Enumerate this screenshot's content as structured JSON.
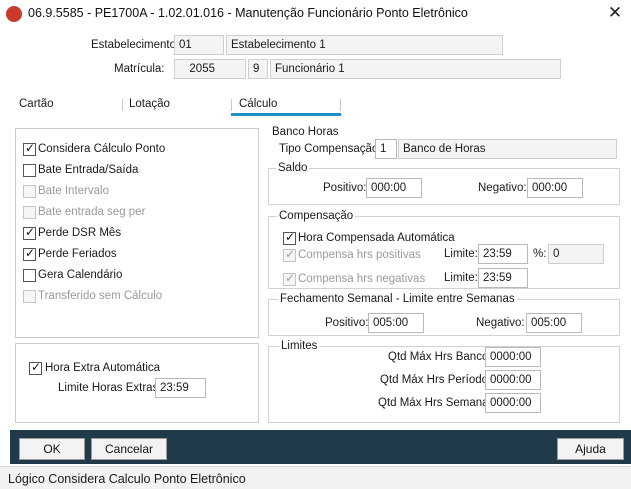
{
  "window": {
    "title": "06.9.5585 - PE1700A - 1.02.01.016 - Manutenção Funcionário Ponto Eletrônico",
    "app_icon": "TOTVS",
    "close_glyph": "✕"
  },
  "header": {
    "estabelecimento_label": "Estabelecimento:",
    "estabelecimento_code": "01",
    "estabelecimento_name": "Estabelecimento 1",
    "matricula_label": "Matrícula:",
    "matricula_code": "2055",
    "matricula_digit": "9",
    "matricula_name": "Funcionário 1"
  },
  "tabs": [
    {
      "label": "Cartão",
      "active": false
    },
    {
      "label": "Lotação",
      "active": false
    },
    {
      "label": "Cálculo",
      "active": true
    }
  ],
  "checkbox_glyph": "✓",
  "left_options": [
    {
      "label": "Considera Cálculo Ponto",
      "checked": true,
      "enabled": true
    },
    {
      "label": "Bate Entrada/Saída",
      "checked": false,
      "enabled": true
    },
    {
      "label": "Bate Intervalo",
      "checked": false,
      "enabled": false
    },
    {
      "label": "Bate entrada seg per",
      "checked": false,
      "enabled": false
    },
    {
      "label": "Perde DSR Mês",
      "checked": true,
      "enabled": true
    },
    {
      "label": "Perde Feriados",
      "checked": true,
      "enabled": true
    },
    {
      "label": "Gera Calendário",
      "checked": false,
      "enabled": true
    },
    {
      "label": "Transferido sem Cálculo",
      "checked": false,
      "enabled": false
    }
  ],
  "hora_extra": {
    "checkbox_label": "Hora Extra Automática",
    "checked": true,
    "limite_label": "Limite Horas Extras:",
    "limite_value": "23:59"
  },
  "banco_horas": {
    "title": "Banco Horas",
    "tipo_label": "Tipo Compensação:",
    "tipo_code": "1",
    "tipo_desc": "Banco de Horas"
  },
  "saldo": {
    "title": "Saldo",
    "positivo_label": "Positivo:",
    "positivo_value": "000:00",
    "negativo_label": "Negativo:",
    "negativo_value": "000:00"
  },
  "compensacao": {
    "title": "Compensação",
    "hora_compensada_label": "Hora Compensada Automática",
    "hora_compensada_checked": true,
    "compensa_positivas_label": "Compensa hrs positivas",
    "compensa_negativas_label": "Compensa hrs negativas",
    "limite_label": "Limite:",
    "limite1_value": "23:59",
    "percent_label": "%:",
    "percent_value": "0",
    "limite2_value": "23:59"
  },
  "fechamento": {
    "title": "Fechamento Semanal - Limite entre Semanas",
    "positivo_label": "Positivo:",
    "positivo_value": "005:00",
    "negativo_label": "Negativo:",
    "negativo_value": "005:00"
  },
  "limites": {
    "title": "Limites",
    "banco_label": "Qtd Máx Hrs Banco:",
    "banco_value": "0000:00",
    "periodo_label": "Qtd Máx Hrs Período:",
    "periodo_value": "0000:00",
    "semana_label": "Qtd Máx Hrs Semana:",
    "semana_value": "0000:00"
  },
  "buttons": {
    "ok": "OK",
    "cancelar": "Cancelar",
    "ajuda": "Ajuda"
  },
  "status_bar": "Lógico Considera Calculo Ponto Eletrônico"
}
